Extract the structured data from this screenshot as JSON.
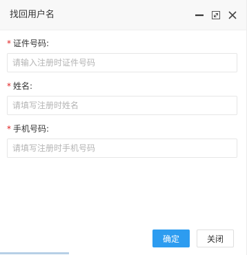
{
  "dialog": {
    "title": "找回用户名",
    "controls": {
      "minimize_icon": "minimize-icon",
      "maximize_icon": "maximize-icon",
      "close_icon": "close-icon"
    }
  },
  "form": {
    "fields": [
      {
        "label": "证件号码:",
        "required": "*",
        "placeholder": "请输入注册时证件号码",
        "value": ""
      },
      {
        "label": "姓名:",
        "required": "*",
        "placeholder": "请填写注册时姓名",
        "value": ""
      },
      {
        "label": "手机号码:",
        "required": "*",
        "placeholder": "请填写注册时手机号码",
        "value": ""
      }
    ]
  },
  "footer": {
    "confirm_label": "确定",
    "close_label": "关闭"
  },
  "colors": {
    "primary": "#2d9cf0",
    "required": "#e02020",
    "titlebar_bg": "#f8f8f8",
    "border": "#e6e6e6"
  }
}
